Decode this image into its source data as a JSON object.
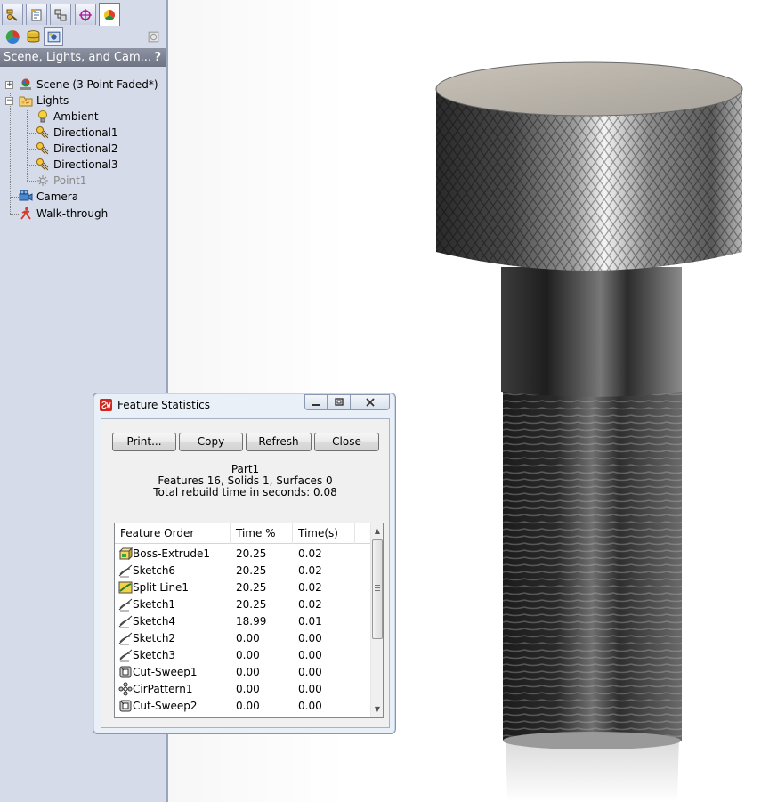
{
  "panel": {
    "tabs": [
      {
        "name": "feature-manager-tab",
        "active": false
      },
      {
        "name": "property-manager-tab",
        "active": false
      },
      {
        "name": "configuration-manager-tab",
        "active": false
      },
      {
        "name": "dimxpert-manager-tab",
        "active": false
      },
      {
        "name": "display-manager-tab",
        "active": true
      }
    ],
    "header_title": "Scene, Lights, and Cam...",
    "help_label": "?",
    "tree": {
      "scene": "Scene (3 Point Faded*)",
      "lights": "Lights",
      "ambient": "Ambient",
      "directional1": "Directional1",
      "directional2": "Directional2",
      "directional3": "Directional3",
      "point1": "Point1",
      "camera": "Camera",
      "walkthrough": "Walk-through"
    },
    "expanders": {
      "scene": "+",
      "lights": "−"
    }
  },
  "dialog": {
    "title": "Feature Statistics",
    "buttons": {
      "print": "Print...",
      "copy": "Copy",
      "refresh": "Refresh",
      "close": "Close"
    },
    "part_name": "Part1",
    "summary": "Features 16, Solids 1, Surfaces 0",
    "rebuild_time": "Total rebuild time in seconds: 0.08",
    "columns": {
      "order": "Feature Order",
      "percent": "Time %",
      "seconds": "Time(s)"
    },
    "rows": [
      {
        "feature": "Boss-Extrude1",
        "percent": "20.25",
        "seconds": "0.02",
        "icon": "boss-extrude-icon"
      },
      {
        "feature": "Sketch6",
        "percent": "20.25",
        "seconds": "0.02",
        "icon": "sketch-icon"
      },
      {
        "feature": "Split Line1",
        "percent": "20.25",
        "seconds": "0.02",
        "icon": "split-line-icon"
      },
      {
        "feature": "Sketch1",
        "percent": "20.25",
        "seconds": "0.02",
        "icon": "sketch-icon"
      },
      {
        "feature": "Sketch4",
        "percent": "18.99",
        "seconds": "0.01",
        "icon": "sketch-icon"
      },
      {
        "feature": "Sketch2",
        "percent": "0.00",
        "seconds": "0.00",
        "icon": "sketch-icon"
      },
      {
        "feature": "Sketch3",
        "percent": "0.00",
        "seconds": "0.00",
        "icon": "sketch-icon"
      },
      {
        "feature": "Cut-Sweep1",
        "percent": "0.00",
        "seconds": "0.00",
        "icon": "cut-sweep-icon"
      },
      {
        "feature": "CirPattern1",
        "percent": "0.00",
        "seconds": "0.00",
        "icon": "circular-pattern-icon"
      },
      {
        "feature": "Cut-Sweep2",
        "percent": "0.00",
        "seconds": "0.00",
        "icon": "cut-sweep-icon"
      }
    ]
  }
}
